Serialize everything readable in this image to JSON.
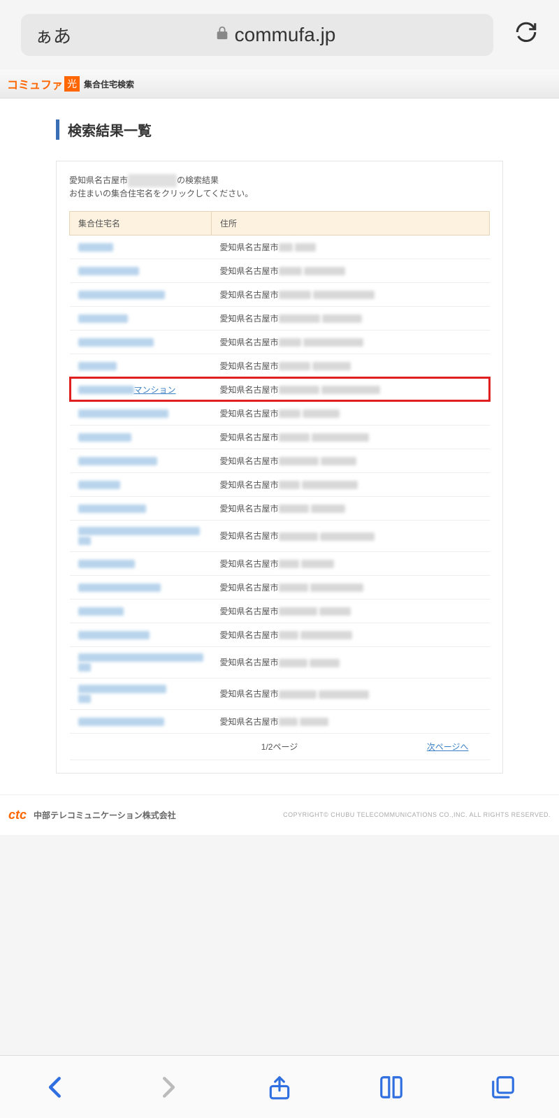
{
  "browser": {
    "aa_label": "ぁあ",
    "domain": "commufa.jp"
  },
  "header": {
    "logo_text": "コミュファ",
    "logo_badge": "光",
    "sublabel": "集合住宅検索"
  },
  "page": {
    "title": "検索結果一覧",
    "intro_prefix": "愛知県名古屋市",
    "intro_suffix": "の検索結果",
    "intro_line2": "お住まいの集合住宅名をクリックしてください。"
  },
  "table": {
    "header_name": "集合住宅名",
    "header_address": "住所",
    "address_prefix": "愛知県名古屋市",
    "highlighted_suffix": "マンション",
    "rows": [
      {
        "highlight": false,
        "multiline": false
      },
      {
        "highlight": false,
        "multiline": false
      },
      {
        "highlight": false,
        "multiline": false
      },
      {
        "highlight": false,
        "multiline": false
      },
      {
        "highlight": false,
        "multiline": false
      },
      {
        "highlight": false,
        "multiline": false
      },
      {
        "highlight": true,
        "multiline": false
      },
      {
        "highlight": false,
        "multiline": false
      },
      {
        "highlight": false,
        "multiline": false
      },
      {
        "highlight": false,
        "multiline": false
      },
      {
        "highlight": false,
        "multiline": false
      },
      {
        "highlight": false,
        "multiline": false
      },
      {
        "highlight": false,
        "multiline": true
      },
      {
        "highlight": false,
        "multiline": false
      },
      {
        "highlight": false,
        "multiline": false
      },
      {
        "highlight": false,
        "multiline": false
      },
      {
        "highlight": false,
        "multiline": false
      },
      {
        "highlight": false,
        "multiline": true
      },
      {
        "highlight": false,
        "multiline": true
      },
      {
        "highlight": false,
        "multiline": false
      }
    ]
  },
  "pager": {
    "current": "1/2ページ",
    "next_label": "次ページへ"
  },
  "footer": {
    "ctc_logo": "ctc",
    "company": "中部テレコミュニケーション株式会社",
    "copyright": "COPYRIGHT© CHUBU TELECOMMUNICATIONS CO.,INC. ALL RIGHTS RESERVED."
  }
}
